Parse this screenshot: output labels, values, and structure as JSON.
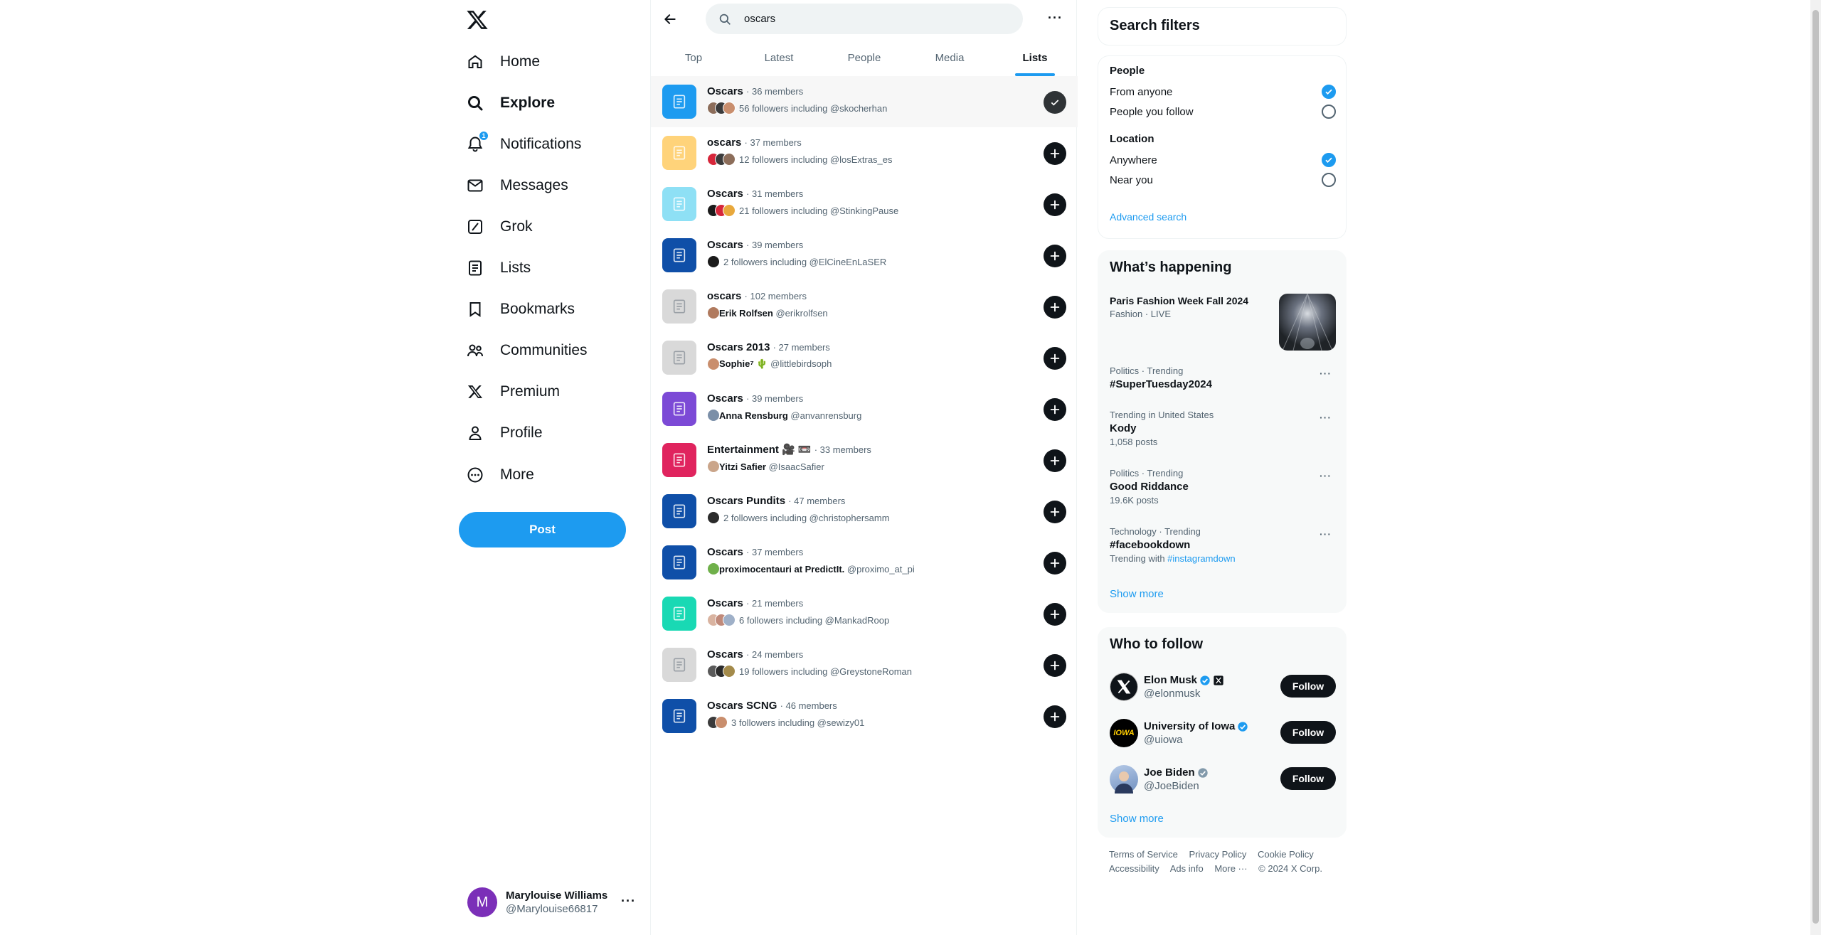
{
  "nav": {
    "items": [
      {
        "label": "Home",
        "icon": "home-icon"
      },
      {
        "label": "Explore",
        "icon": "search-icon"
      },
      {
        "label": "Notifications",
        "icon": "bell-icon",
        "badge": "1"
      },
      {
        "label": "Messages",
        "icon": "envelope-icon"
      },
      {
        "label": "Grok",
        "icon": "grok-icon"
      },
      {
        "label": "Lists",
        "icon": "list-icon"
      },
      {
        "label": "Bookmarks",
        "icon": "bookmark-icon"
      },
      {
        "label": "Communities",
        "icon": "people-icon"
      },
      {
        "label": "Premium",
        "icon": "x-logo-icon"
      },
      {
        "label": "Profile",
        "icon": "person-icon"
      },
      {
        "label": "More",
        "icon": "more-circle-icon"
      }
    ],
    "post_label": "Post",
    "account": {
      "initial": "M",
      "name": "Marylouise Williams",
      "handle": "@Marylouise66817",
      "avatar_color": "#7b2fb8"
    }
  },
  "search": {
    "value": "oscars"
  },
  "tabs": [
    {
      "label": "Top",
      "active": false
    },
    {
      "label": "Latest",
      "active": false
    },
    {
      "label": "People",
      "active": false
    },
    {
      "label": "Media",
      "active": false
    },
    {
      "label": "Lists",
      "active": true
    }
  ],
  "lists": [
    {
      "name": "Oscars",
      "members": "· 36 members",
      "followers": "56 followers including @skocherhan",
      "color": "#1d9bf0",
      "joined": true
    },
    {
      "name": "oscars",
      "members": "· 37 members",
      "followers": "12 followers including @losExtras_es",
      "color": "#ffd37a",
      "joined": false
    },
    {
      "name": "Oscars",
      "members": "· 31 members",
      "followers": "21 followers including @StinkingPause",
      "color": "#8ee0f5",
      "joined": false
    },
    {
      "name": "Oscars",
      "members": "· 39 members",
      "followers": "2 followers including @ElCineEnLaSER",
      "color": "#0f4fa8",
      "joined": false
    },
    {
      "name": "oscars",
      "members": "· 102 members",
      "owner": "Erik Rolfsen",
      "owner_handle": "@erikrolfsen",
      "color": "#d9d9d9",
      "joined": false
    },
    {
      "name": "Oscars 2013",
      "members": "· 27 members",
      "owner": "Sophie⁷ 🌵",
      "owner_handle": "@littlebirdsoph",
      "color": "#d9d9d9",
      "joined": false
    },
    {
      "name": "Oscars",
      "members": "· 39 members",
      "owner": "Anna Rensburg",
      "owner_handle": "@anvanrensburg",
      "color": "#7c4ad6",
      "joined": false
    },
    {
      "name": "Entertainment 🎥 📼",
      "members": "· 33 members",
      "owner": "Yitzi Safier",
      "owner_handle": "@IsaacSafier",
      "color": "#e0245e",
      "joined": false
    },
    {
      "name": "Oscars Pundits",
      "members": "· 47 members",
      "followers": "2 followers including @christophersamm",
      "color": "#0f4fa8",
      "joined": false
    },
    {
      "name": "Oscars",
      "members": "· 37 members",
      "owner": "proximocentauri at PredictIt.",
      "owner_handle": "@proximo_at_pi",
      "color": "#0f4fa8",
      "joined": false
    },
    {
      "name": "Oscars",
      "members": "· 21 members",
      "followers": "6 followers including @MankadRoop",
      "color": "#19d9b4",
      "joined": false
    },
    {
      "name": "Oscars",
      "members": "· 24 members",
      "followers": "19 followers including @GreystoneRoman",
      "color": "#d9d9d9",
      "joined": false
    },
    {
      "name": "Oscars SCNG",
      "members": "· 46 members",
      "followers": "3 followers including @sewizy01",
      "color": "#0f4fa8",
      "joined": false
    }
  ],
  "filters": {
    "title": "Search filters",
    "people_heading": "People",
    "people_options": [
      {
        "label": "From anyone",
        "checked": true
      },
      {
        "label": "People you follow",
        "checked": false
      }
    ],
    "location_heading": "Location",
    "location_options": [
      {
        "label": "Anywhere",
        "checked": true
      },
      {
        "label": "Near you",
        "checked": false
      }
    ],
    "advanced": "Advanced search"
  },
  "happening": {
    "title": "What’s happening",
    "featured": {
      "name": "Paris Fashion Week Fall 2024",
      "meta": "Fashion · LIVE"
    },
    "trends": [
      {
        "category": "Politics · Trending",
        "name": "#SuperTuesday2024",
        "posts": ""
      },
      {
        "category": "Trending in United States",
        "name": "Kody",
        "posts": "1,058 posts"
      },
      {
        "category": "Politics · Trending",
        "name": "Good Riddance",
        "posts": "19.6K posts"
      },
      {
        "category": "Technology · Trending",
        "name": "#facebookdown",
        "posts_prefix": "Trending with ",
        "posts_link": "#instagramdown"
      }
    ],
    "show_more": "Show more"
  },
  "who_to_follow": {
    "title": "Who to follow",
    "people": [
      {
        "name": "Elon Musk",
        "handle": "@elonmusk",
        "badge": "blue-check-icon",
        "follow": "Follow"
      },
      {
        "name": "University of Iowa",
        "handle": "@uiowa",
        "badge": "blue-check-icon",
        "follow": "Follow"
      },
      {
        "name": "Joe Biden",
        "handle": "@JoeBiden",
        "badge": "gray-check-icon",
        "follow": "Follow"
      }
    ],
    "show_more": "Show more"
  },
  "footer": {
    "links": [
      "Terms of Service",
      "Privacy Policy",
      "Cookie Policy",
      "Accessibility",
      "Ads info",
      "More ···"
    ],
    "copyright": "© 2024 X Corp."
  }
}
